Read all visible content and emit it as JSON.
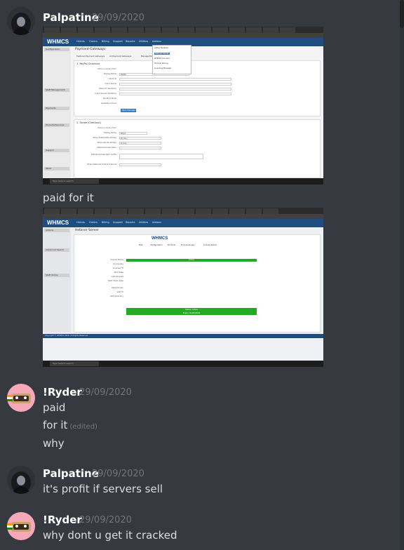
{
  "messages": [
    {
      "user": "Palpatine",
      "timestamp": "29/09/2020",
      "lines": [],
      "attachments": [
        "whmcs-payment-gateways",
        "whmcs-hetzner-license"
      ]
    },
    {
      "user": "Palpatine",
      "timestamp": "",
      "lines": [
        "paid for it"
      ]
    },
    {
      "user": "!Ryder",
      "timestamp": "29/09/2020",
      "lines": [
        "paid",
        "for it",
        "why"
      ],
      "edited_label": "(edited)"
    },
    {
      "user": "Palpatine",
      "timestamp": "29/09/2020",
      "lines": [
        "it's profit if servers sell"
      ]
    },
    {
      "user": "!Ryder",
      "timestamp": "29/09/2020",
      "lines": [
        "why dont u get it cracked"
      ]
    }
  ],
  "shot1": {
    "logo": "WHMCS",
    "nav": [
      "Clients",
      "Orders",
      "Billing",
      "Support",
      "Reports",
      "Utilities",
      "Addons"
    ],
    "page_title": "Payment Gateways",
    "tabs": [
      "Featured Payment Gateways",
      "All Payment Gateways",
      "Manage Existing Gateways"
    ],
    "section1_title": "1. PayPal Checkout",
    "section2_title": "2. Stripe (Checkout)",
    "fields1": [
      "Show on Order Form",
      "Display Name",
      "Client ID",
      "Client Secret",
      "Client ID (Sandbox)",
      "Client Secret (Sandbox)",
      "Sandbox Mode",
      "Available Actions"
    ],
    "values1": [
      "",
      "PayPal",
      "",
      "",
      "",
      "",
      "",
      ""
    ],
    "fields2": [
      "Show on Order Form",
      "Display Name",
      "Stripe Publishable API Key",
      "Stripe Secret API Key",
      "Statement Descriptor",
      "Statement Descriptor Suffix",
      "Stripe Webhook Endpoint Secret"
    ],
    "values2": [
      "",
      "Stripe",
      "pk_live_",
      "sk_live_",
      "",
      "",
      ""
    ],
    "save_label": "Save Changes",
    "dropdown": [
      "Addon Modules",
      "Hetzner Server",
      "WHMCS Connect",
      "Domain Pricing",
      "Licensing Manager"
    ],
    "taskbar_search": "Type here to search",
    "sidebar_heads": [
      "Configuration",
      "Staff Management",
      "Payments",
      "Products/Services",
      "Support",
      "Other"
    ]
  },
  "shot2": {
    "logo": "WHMCS",
    "nav": [
      "Clients",
      "Orders",
      "Billing",
      "Support",
      "Reports",
      "Utilities",
      "Addons"
    ],
    "page_title": "Hetzner Server",
    "tabs": [
      "Main",
      "Configuration",
      "Products",
      "Price Overview",
      "License Status"
    ],
    "license_rows": [
      "License Status",
      "License Key",
      "Licensed To",
      "Start Date",
      "Last Checked",
      "Next Check Date",
      "Valid Domain",
      "Valid IP",
      "Valid Directory"
    ],
    "status_text": "Active",
    "bottom_status": "Status: Active",
    "bottom_expiry": "Expiry: 01/05/2020",
    "sidebar_heads": [
      "Addons",
      "Advanced Search",
      "Staff Online"
    ],
    "footer_left": "Copyright © WHMCS 2020. All Rights Reserved."
  },
  "colors": {
    "bg": "#36393f",
    "username": "#ffffff",
    "timestamp": "#72767d",
    "text": "#dcddde",
    "whmcs_blue": "#1f4d80"
  }
}
